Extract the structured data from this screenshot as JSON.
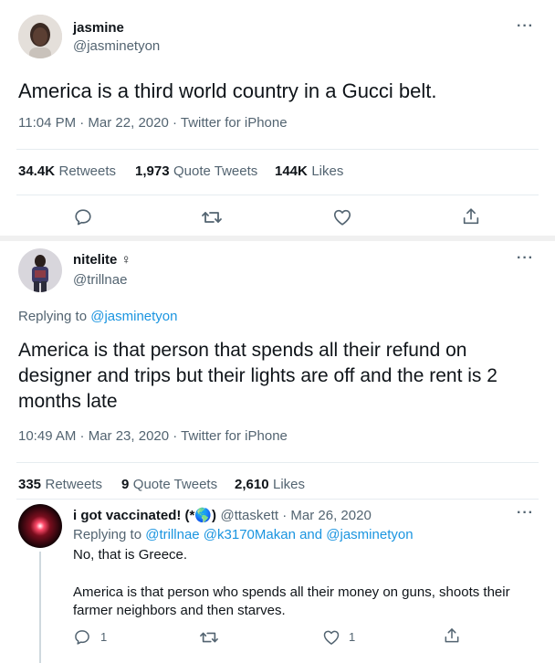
{
  "tweet1": {
    "name": "jasmine",
    "handle": "@jasminetyon",
    "text": "America is a third world country in a Gucci belt.",
    "timestamp": "11:04 PM · Mar 22, 2020 · Twitter for iPhone",
    "stats": {
      "retweets_count": "34.4K",
      "retweets_label": "Retweets",
      "quotes_count": "1,973",
      "quotes_label": "Quote Tweets",
      "likes_count": "144K",
      "likes_label": "Likes"
    }
  },
  "tweet2": {
    "name": "nitelite ♀",
    "handle": "@trillnae",
    "replying_prefix": "Replying to",
    "replying_to": "@jasminetyon",
    "text": "America is that person that spends all their refund on designer and trips but their lights are off and the rent is 2 months late",
    "timestamp": "10:49 AM · Mar 23, 2020 · Twitter for iPhone",
    "stats": {
      "retweets_count": "335",
      "retweets_label": "Retweets",
      "quotes_count": "9",
      "quotes_label": "Quote Tweets",
      "likes_count": "2,610",
      "likes_label": "Likes"
    }
  },
  "tweet3": {
    "name": "i got vaccinated! (*🌎)",
    "handle_date": "@ttaskett · Mar 26, 2020",
    "replying_prefix": "Replying to",
    "replying_to": "@trillnae @k3170Makan and @jasminetyon",
    "line1": "No, that is Greece.",
    "line2": "America is that person who spends all their money on guns, shoots their farmer neighbors and then starves.",
    "reply_count": "1",
    "like_count": "1"
  },
  "more_glyph": "···",
  "colors": {
    "accent": "#1b95e0",
    "text": "#0f1419",
    "muted": "#536471",
    "divider": "#e6ecf0"
  }
}
